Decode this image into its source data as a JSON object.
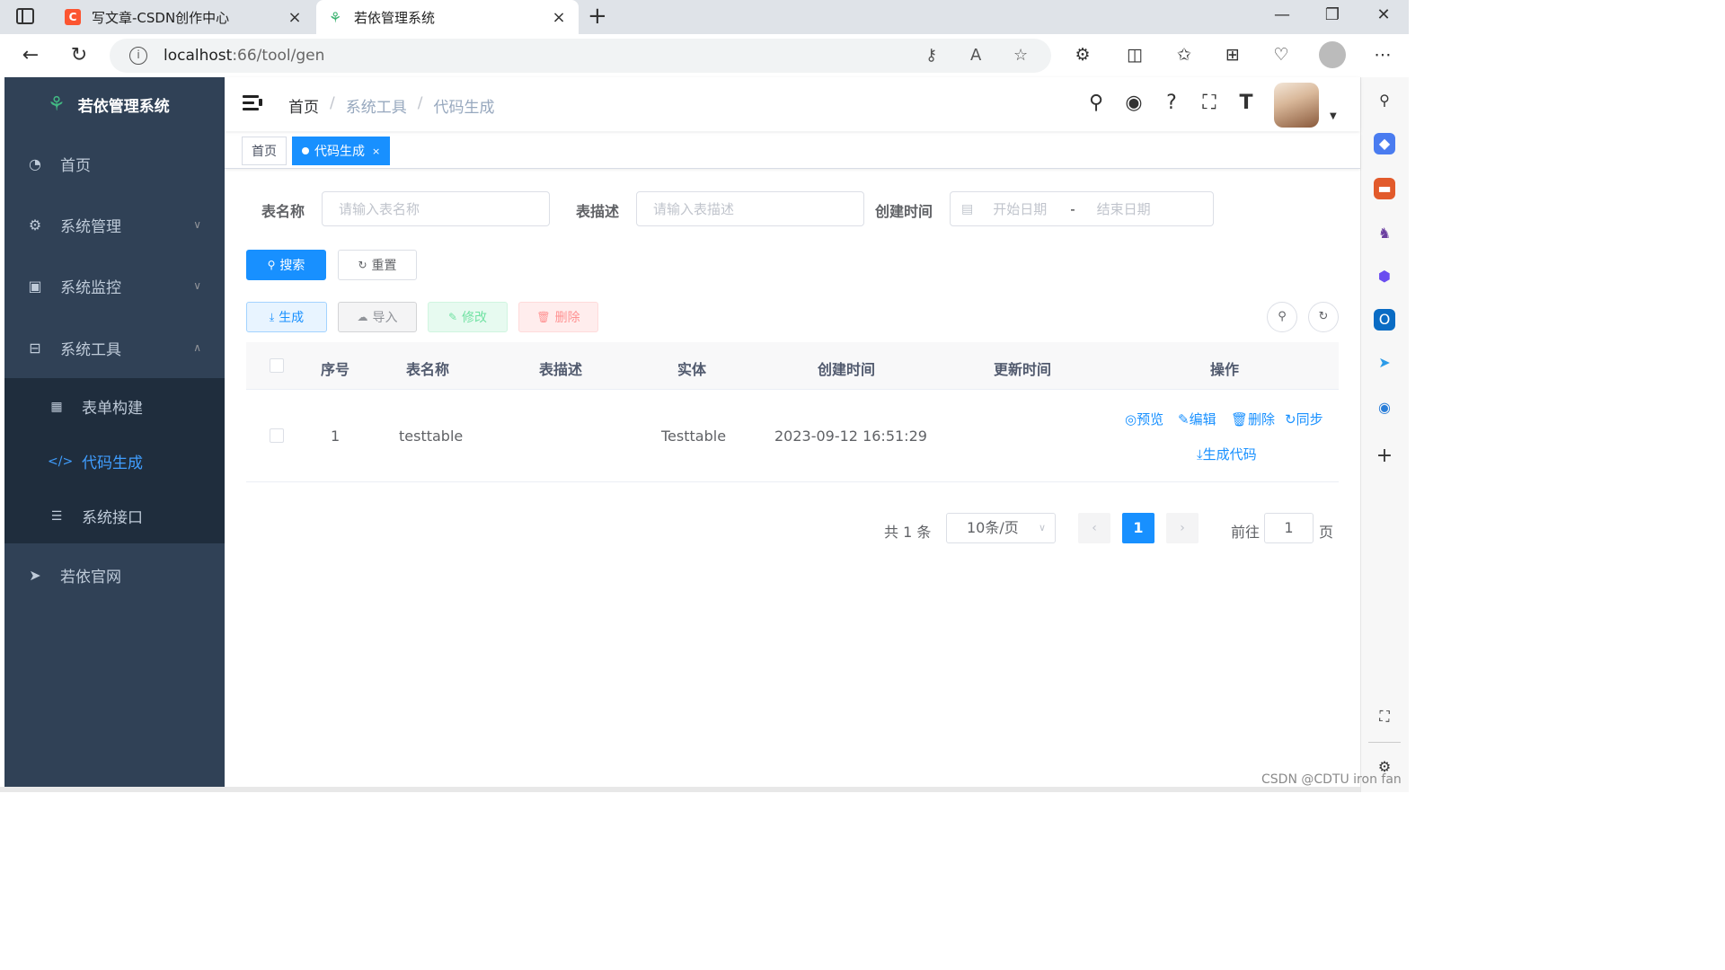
{
  "browser": {
    "tabs": [
      {
        "title": "写文章-CSDN创作中心",
        "favicon": "C"
      },
      {
        "title": "若依管理系统",
        "favicon": "ruoyi-logo"
      }
    ],
    "url_host": "localhost",
    "url_path": ":66/tool/gen"
  },
  "app": {
    "title": "若依管理系统",
    "menu": {
      "home": "首页",
      "system": "系统管理",
      "monitor": "系统监控",
      "tool": "系统工具",
      "sub": {
        "form_build": "表单构建",
        "gen": "代码生成",
        "swagger": "系统接口"
      },
      "site": "若依官网"
    },
    "breadcrumb": [
      "首页",
      "系统工具",
      "代码生成"
    ],
    "tags": {
      "home": "首页",
      "gen": "代码生成",
      "close": "×"
    }
  },
  "search": {
    "table_name_label": "表名称",
    "table_name_placeholder": "请输入表名称",
    "table_comment_label": "表描述",
    "table_comment_placeholder": "请输入表描述",
    "create_time_label": "创建时间",
    "start_date_placeholder": "开始日期",
    "range_sep": "-",
    "end_date_placeholder": "结束日期",
    "search_btn": "搜索",
    "reset_btn": "重置"
  },
  "toolbar": {
    "gen": "生成",
    "import": "导入",
    "edit": "修改",
    "delete": "删除"
  },
  "table": {
    "headers": [
      "序号",
      "表名称",
      "表描述",
      "实体",
      "创建时间",
      "更新时间",
      "操作"
    ],
    "rows": [
      {
        "index": "1",
        "table_name": "testtable",
        "table_comment": "",
        "class_name": "Testtable",
        "create_time": "2023-09-12 16:51:29",
        "update_time": "",
        "ops": {
          "preview": "预览",
          "edit": "编辑",
          "delete": "删除",
          "sync": "同步",
          "gen_code": "生成代码"
        }
      }
    ]
  },
  "pagination": {
    "total": "共 1 条",
    "page_size": "10条/页",
    "current": "1",
    "goto_label": "前往",
    "goto_value": "1",
    "page_suffix": "页"
  },
  "watermark": "CSDN @CDTU iron fan",
  "colors": {
    "sidebar_bg": "#304156",
    "submenu_bg": "#1f2d3d",
    "primary": "#1890ff",
    "active_menu": "#409eff"
  }
}
